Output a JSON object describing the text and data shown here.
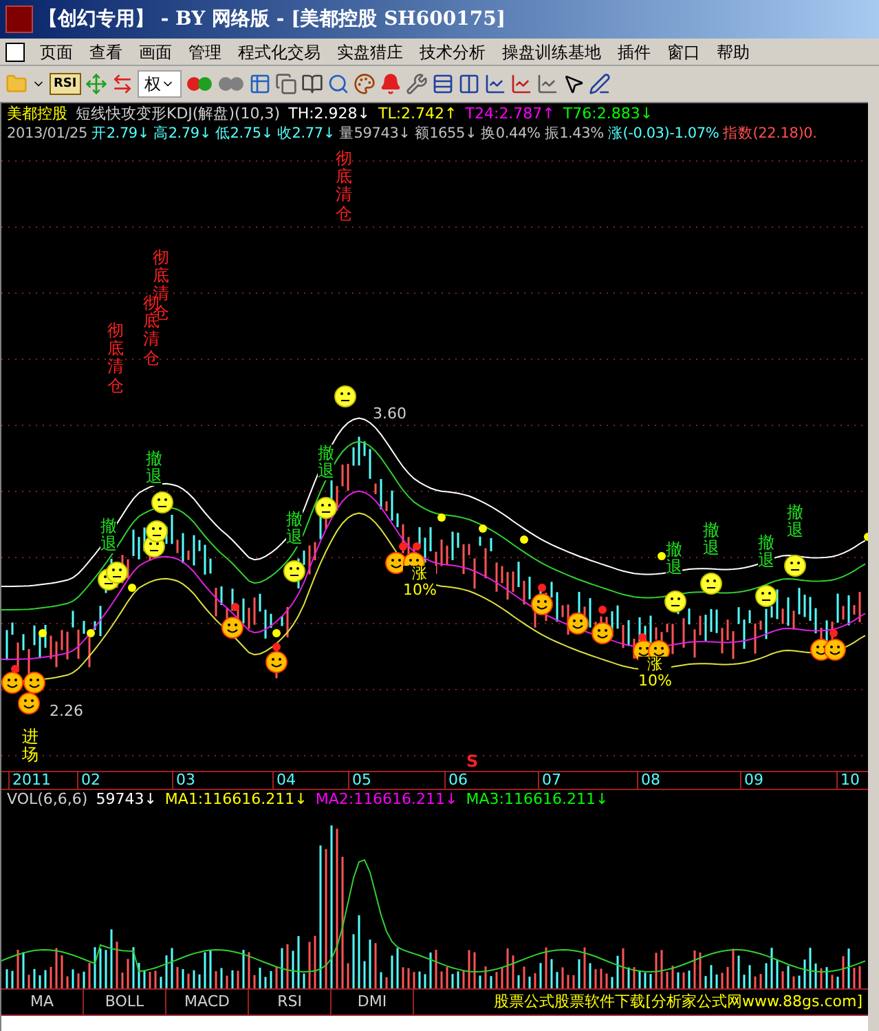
{
  "window": {
    "title": "【创幻专用】 - BY 网络版 - [美都控股 SH600175]"
  },
  "menu": [
    "页面",
    "查看",
    "画面",
    "管理",
    "程式化交易",
    "实盘猎庄",
    "技术分析",
    "操盘训练基地",
    "插件",
    "窗口",
    "帮助"
  ],
  "toolbar": {
    "indicator_button": "RSI",
    "rights_dropdown": "权"
  },
  "indicator_line": {
    "stock": "美都控股",
    "formula": "短线快攻变形KDJ(解盘)(10,3)",
    "values": [
      {
        "text": "TH:2.928↓",
        "color": "#ffffff"
      },
      {
        "text": "TL:2.742↑",
        "color": "#ffff00"
      },
      {
        "text": "T24:2.787↑",
        "color": "#ff00ff"
      },
      {
        "text": "T76:2.883↓",
        "color": "#00ff00"
      }
    ]
  },
  "quote_line": [
    {
      "text": "2013/01/25",
      "color": "#c0c0c0"
    },
    {
      "text": "开2.79↓",
      "color": "#54ffff"
    },
    {
      "text": "高2.79↓",
      "color": "#54ffff"
    },
    {
      "text": "低2.75↓",
      "color": "#54ffff"
    },
    {
      "text": "收2.77↓",
      "color": "#54ffff"
    },
    {
      "text": "量59743↓",
      "color": "#c0c0c0"
    },
    {
      "text": "额1655↓",
      "color": "#c0c0c0"
    },
    {
      "text": "换0.44%",
      "color": "#c0c0c0"
    },
    {
      "text": "振1.43%",
      "color": "#c0c0c0"
    },
    {
      "text": "涨(-0.03)-1.07%",
      "color": "#54ffff"
    },
    {
      "text": "指数(22.18)0.",
      "color": "#ff5050"
    }
  ],
  "annotations": [
    {
      "kind": "clear",
      "text": "彻底清仓"
    },
    {
      "kind": "clear",
      "text": "彻底清仓"
    },
    {
      "kind": "clear",
      "text": "彻底清仓"
    },
    {
      "kind": "clear",
      "text": "彻底清仓"
    },
    {
      "kind": "retreat",
      "text": "撤退"
    },
    {
      "kind": "retreat",
      "text": "撤退"
    },
    {
      "kind": "retreat",
      "text": "撤退"
    },
    {
      "kind": "retreat",
      "text": "撤退"
    },
    {
      "kind": "retreat",
      "text": "撤退"
    },
    {
      "kind": "retreat",
      "text": "撤退"
    },
    {
      "kind": "retreat",
      "text": "撤退"
    },
    {
      "kind": "retreat",
      "text": "撤退"
    },
    {
      "kind": "price",
      "text": "3.60"
    },
    {
      "kind": "price",
      "text": "2.26"
    },
    {
      "kind": "gain",
      "text": "涨10%"
    },
    {
      "kind": "gain",
      "text": "涨10%"
    },
    {
      "kind": "entry",
      "text": "进场"
    },
    {
      "kind": "sell",
      "text": "S"
    }
  ],
  "x_axis": [
    "2011",
    "02",
    "03",
    "04",
    "05",
    "06",
    "07",
    "08",
    "09",
    "10"
  ],
  "volume_line": {
    "label": "VOL(6,6,6)",
    "values": [
      {
        "text": "59743↓",
        "color": "#ffffff"
      },
      {
        "text": "MA1:116616.211↓",
        "color": "#ffff00"
      },
      {
        "text": "MA2:116616.211↓",
        "color": "#ff00ff"
      },
      {
        "text": "MA3:116616.211↓",
        "color": "#00ff00"
      }
    ]
  },
  "tabs": [
    {
      "label": "MA",
      "selected": false
    },
    {
      "label": "BOLL",
      "selected": false
    },
    {
      "label": "MACD",
      "selected": false
    },
    {
      "label": "RSI",
      "selected": false
    },
    {
      "label": "DMI",
      "selected": false
    }
  ],
  "status_text": "股票公式股票软件下载[分析家公式网www.88gs.com]"
}
